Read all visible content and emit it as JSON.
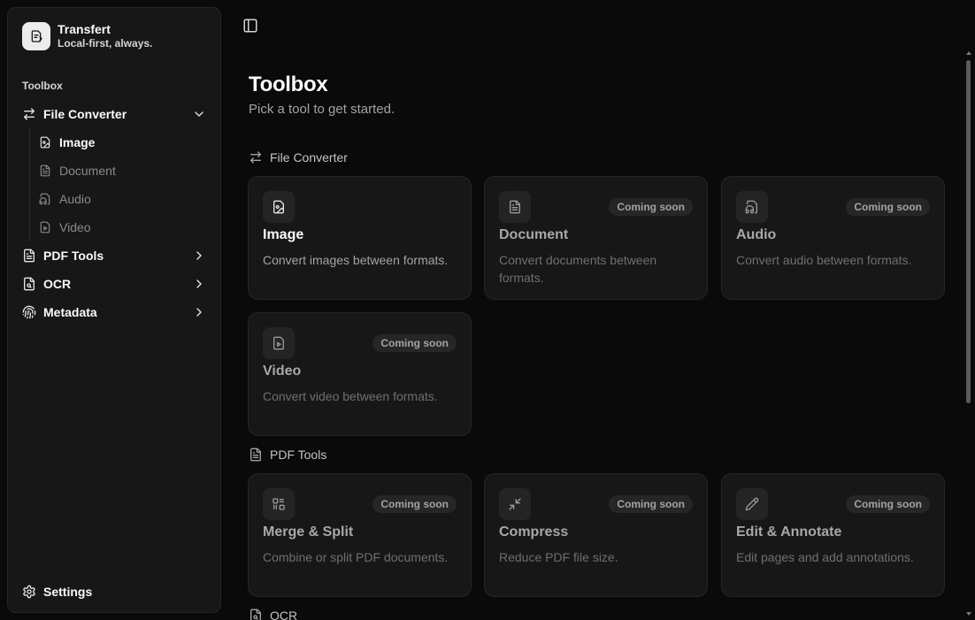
{
  "brand": {
    "name": "Transfert",
    "tagline": "Local-first, always."
  },
  "sidebar": {
    "section_label": "Toolbox",
    "items": [
      {
        "label": "File Converter",
        "icon": "arrows-swap-icon",
        "expanded": true,
        "children": [
          {
            "label": "Image",
            "icon": "file-image-icon",
            "active": true
          },
          {
            "label": "Document",
            "icon": "file-text-icon"
          },
          {
            "label": "Audio",
            "icon": "file-audio-icon"
          },
          {
            "label": "Video",
            "icon": "file-video-icon"
          }
        ]
      },
      {
        "label": "PDF Tools",
        "icon": "file-text-icon",
        "expanded": false
      },
      {
        "label": "OCR",
        "icon": "file-scan-icon",
        "expanded": false
      },
      {
        "label": "Metadata",
        "icon": "fingerprint-icon",
        "expanded": false
      }
    ],
    "settings_label": "Settings"
  },
  "main": {
    "title": "Toolbox",
    "subtitle": "Pick a tool to get started.",
    "sections": [
      {
        "heading": "File Converter",
        "icon": "arrows-swap-icon",
        "cards": [
          {
            "title": "Image",
            "description": "Convert images between formats.",
            "icon": "file-image-icon",
            "badge": ""
          },
          {
            "title": "Document",
            "description": "Convert documents between formats.",
            "icon": "file-text-icon",
            "badge": "Coming soon"
          },
          {
            "title": "Audio",
            "description": "Convert audio between formats.",
            "icon": "file-audio-icon",
            "badge": "Coming soon"
          },
          {
            "title": "Video",
            "description": "Convert video between formats.",
            "icon": "file-video-icon",
            "badge": "Coming soon"
          }
        ]
      },
      {
        "heading": "PDF Tools",
        "icon": "file-text-icon",
        "cards": [
          {
            "title": "Merge & Split",
            "description": "Combine or split PDF documents.",
            "icon": "merge-split-icon",
            "badge": "Coming soon"
          },
          {
            "title": "Compress",
            "description": "Reduce PDF file size.",
            "icon": "compress-icon",
            "badge": "Coming soon"
          },
          {
            "title": "Edit & Annotate",
            "description": "Edit pages and add annotations.",
            "icon": "pencil-icon",
            "badge": "Coming soon"
          }
        ]
      },
      {
        "heading": "OCR",
        "icon": "file-scan-icon",
        "cards": []
      }
    ]
  }
}
